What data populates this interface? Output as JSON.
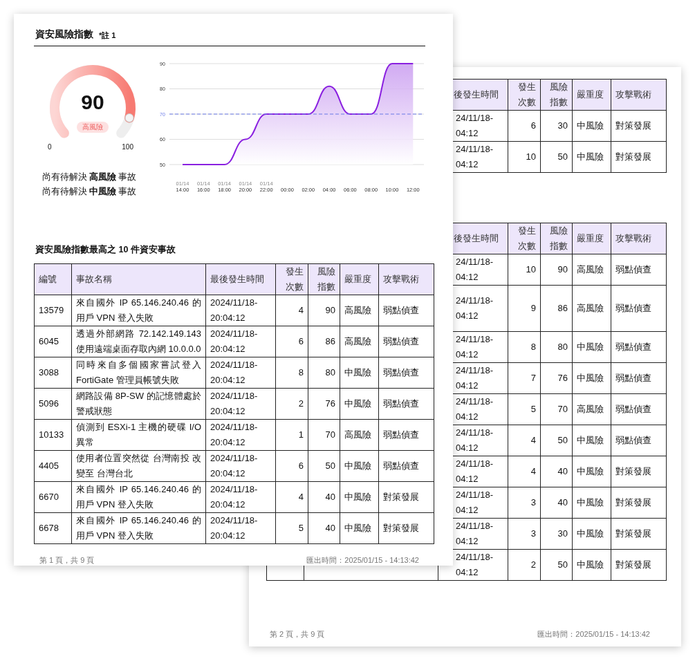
{
  "front_page": {
    "title": "資安風險指數",
    "note": "*註 1",
    "gauge": {
      "value": "90",
      "level": 0.9,
      "badge": "高風險",
      "min_label": "0",
      "max_label": "100"
    },
    "pending": [
      "尚有待解決 **高風險** 事故",
      "尚有待解決 **中風險** 事故"
    ],
    "chart_data": {
      "type": "area",
      "categories": [
        "01/14 14:00",
        "01/14 16:00",
        "01/14 18:00",
        "01/14 20:00",
        "01/14 22:00",
        "00:00",
        "02:00",
        "04:00",
        "06:00",
        "08:00",
        "10:00",
        "12:00"
      ],
      "series": [
        {
          "color": "#8a20e0",
          "values": [
            50,
            50,
            50,
            60,
            70,
            70,
            70,
            81,
            70,
            70,
            90,
            90
          ]
        }
      ],
      "ylim": [
        50,
        90
      ],
      "yticks": [
        50,
        60,
        70,
        80,
        90
      ],
      "grid": true,
      "ref_lines": [
        {
          "axis": "y",
          "value": 70,
          "color": "#6a7be8"
        }
      ]
    },
    "table_title": "資安風險指數最高之 10 件資安事故",
    "columns": [
      "編號",
      "事故名稱",
      "最後發生時間",
      "發生次數",
      "風險指數",
      "嚴重度",
      "攻擊戰術"
    ],
    "rows": [
      {
        "id": "13579",
        "name": "來自國外 IP 65.146.240.46 的用戶 VPN 登入失敗",
        "time": "2024/11/18-\n20:04:12",
        "count": "4",
        "index": "90",
        "severity": "高風險",
        "tactic": "弱點偵查"
      },
      {
        "id": "6045",
        "name": "透過外部網路 72.142.149.143 使用遠端桌面存取內網 10.0.0.0",
        "time": "2024/11/18-\n20:04:12",
        "count": "6",
        "index": "86",
        "severity": "高風險",
        "tactic": "弱點偵查"
      },
      {
        "id": "3088",
        "name": "同時來自多個國家嘗試登入 FortiGate 管理員帳號失敗",
        "time": "2024/11/18-\n20:04:12",
        "count": "8",
        "index": "80",
        "severity": "中風險",
        "tactic": "弱點偵查"
      },
      {
        "id": "5096",
        "name": "網路設備 8P-SW 的記憶體處於警戒狀態",
        "time": "2024/11/18-\n20:04:12",
        "count": "2",
        "index": "76",
        "severity": "中風險",
        "tactic": "弱點偵查"
      },
      {
        "id": "10133",
        "name": "偵測到 ESXi-1 主機的硬碟 I/O 異常",
        "time": "2024/11/18-\n20:04:12",
        "count": "1",
        "index": "70",
        "severity": "高風險",
        "tactic": "弱點偵查"
      },
      {
        "id": "4405",
        "name": "使用者位置突然從 台灣南投 改變至 台灣台北",
        "time": "2024/11/18-\n20:04:12",
        "count": "6",
        "index": "50",
        "severity": "中風險",
        "tactic": "弱點偵查"
      },
      {
        "id": "6670",
        "name": "來自國外 IP 65.146.240.46 的用戶 VPN 登入失敗",
        "time": "2024/11/18-\n20:04:12",
        "count": "4",
        "index": "40",
        "severity": "中風險",
        "tactic": "對策發展"
      },
      {
        "id": "6678",
        "name": "來自國外 IP 65.146.240.46 的用戶 VPN 登入失敗",
        "time": "2024/11/18-\n20:04:12",
        "count": "5",
        "index": "40",
        "severity": "中風險",
        "tactic": "對策發展"
      }
    ],
    "footer": {
      "page": "第 1 頁，共 9 頁",
      "exported": "匯出時間：2025/01/15 - 14:13:42"
    }
  },
  "back_page": {
    "tables": [
      {
        "columns": [
          "後發生時間",
          "發生次數",
          "風險指數",
          "嚴重度",
          "攻擊戰術"
        ],
        "rows": [
          {
            "time": "24/11/18-\n04:12",
            "count": "6",
            "index": "30",
            "severity": "中風險",
            "tactic": "對策發展",
            "tall": false
          },
          {
            "time": "24/11/18-\n04:12",
            "count": "10",
            "index": "50",
            "severity": "中風險",
            "tactic": "對策發展",
            "tall": false
          }
        ]
      },
      {
        "columns": [
          "後發生時間",
          "發生次數",
          "風險指數",
          "嚴重度",
          "攻擊戰術"
        ],
        "rows": [
          {
            "time": "24/11/18-\n04:12",
            "count": "10",
            "index": "90",
            "severity": "高風險",
            "tactic": "弱點偵查",
            "tall": false
          },
          {
            "time": "24/11/18-\n04:12",
            "count": "9",
            "index": "86",
            "severity": "高風險",
            "tactic": "弱點偵查",
            "tall": true
          },
          {
            "time": "24/11/18-\n04:12",
            "count": "8",
            "index": "80",
            "severity": "中風險",
            "tactic": "弱點偵查",
            "tall": false
          },
          {
            "time": "24/11/18-\n04:12",
            "count": "7",
            "index": "76",
            "severity": "中風險",
            "tactic": "弱點偵查",
            "tall": false
          },
          {
            "time": "24/11/18-\n04:12",
            "count": "5",
            "index": "70",
            "severity": "高風險",
            "tactic": "弱點偵查",
            "tall": false
          },
          {
            "time": "24/11/18-\n04:12",
            "count": "4",
            "index": "50",
            "severity": "中風險",
            "tactic": "弱點偵查",
            "tall": false
          },
          {
            "time": "24/11/18-\n04:12",
            "count": "4",
            "index": "40",
            "severity": "中風險",
            "tactic": "對策發展",
            "tall": false
          },
          {
            "time": "24/11/18-\n04:12",
            "count": "3",
            "index": "40",
            "severity": "中風險",
            "tactic": "對策發展",
            "tall": false
          },
          {
            "time": "24/11/18-\n04:12",
            "count": "3",
            "index": "30",
            "severity": "中風險",
            "tactic": "對策發展",
            "tall": false
          },
          {
            "time": "24/11/18-\n04:12",
            "count": "2",
            "index": "50",
            "severity": "中風險",
            "tactic": "對策發展",
            "tall": false
          }
        ]
      }
    ],
    "footer": {
      "page": "第 2 頁，共 9 頁",
      "exported": "匯出時間：2025/01/15 - 14:13:42"
    }
  }
}
